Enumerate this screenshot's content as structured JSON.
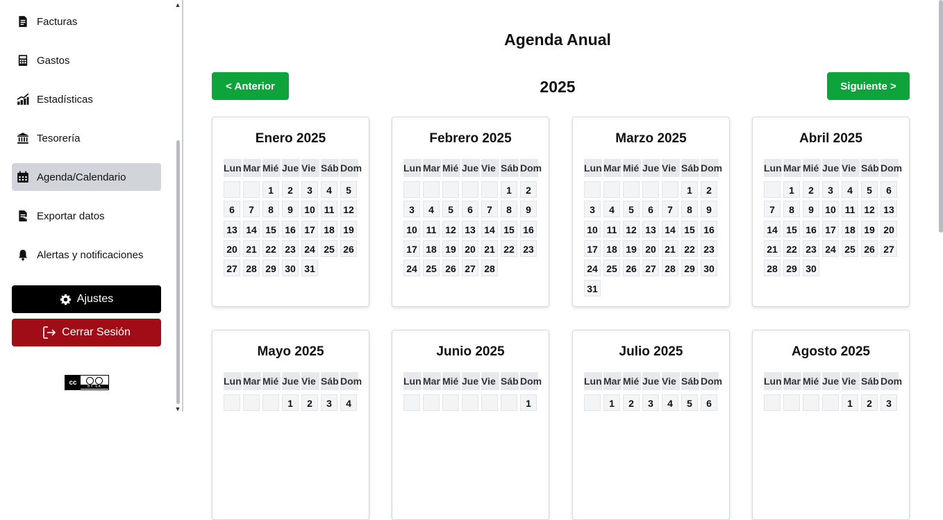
{
  "sidebar": {
    "items": [
      {
        "label": "Facturas",
        "icon": "invoice-icon",
        "active": false
      },
      {
        "label": "Gastos",
        "icon": "calculator-icon",
        "active": false
      },
      {
        "label": "Estadísticas",
        "icon": "bar-chart-icon",
        "active": false
      },
      {
        "label": "Tesorería",
        "icon": "bank-icon",
        "active": false
      },
      {
        "label": "Agenda/Calendario",
        "icon": "calendar-icon",
        "active": true
      },
      {
        "label": "Exportar datos",
        "icon": "export-file-icon",
        "active": false
      },
      {
        "label": "Alertas y notificaciones",
        "icon": "bell-icon",
        "active": false
      }
    ],
    "settings_label": "Ajustes",
    "logout_label": "Cerrar Sesión",
    "license": {
      "cc": "cc",
      "text": "BY  SA"
    }
  },
  "main": {
    "title": "Agenda Anual",
    "year": "2025",
    "prev_label": "< Anterior",
    "next_label": "Siguiente >",
    "weekdays": [
      "Lun",
      "Mar",
      "Mié",
      "Jue",
      "Vie",
      "Sáb",
      "Dom"
    ],
    "months": [
      {
        "title": "Enero 2025",
        "offset": 2,
        "days": 31
      },
      {
        "title": "Febrero 2025",
        "offset": 5,
        "days": 28
      },
      {
        "title": "Marzo 2025",
        "offset": 5,
        "days": 31
      },
      {
        "title": "Abril 2025",
        "offset": 1,
        "days": 30
      },
      {
        "title": "Mayo 2025",
        "offset": 3,
        "days": 4
      },
      {
        "title": "Junio 2025",
        "offset": 6,
        "days": 1
      },
      {
        "title": "Julio 2025",
        "offset": 1,
        "days": 6
      },
      {
        "title": "Agosto 2025",
        "offset": 4,
        "days": 3
      }
    ]
  },
  "colors": {
    "accent_green": "#0ea33b",
    "logout_red": "#a10d16",
    "active_item": "#d1d5db"
  }
}
